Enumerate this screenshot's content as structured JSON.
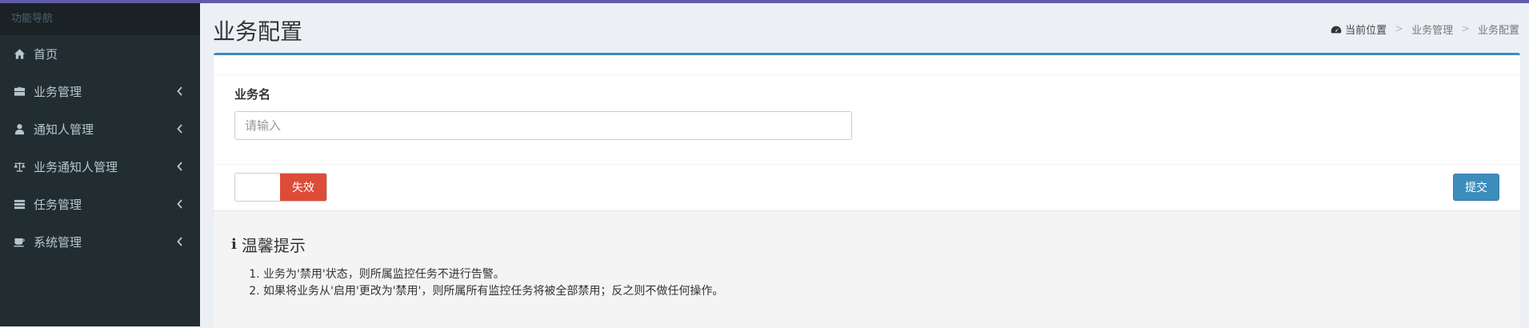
{
  "sidebar": {
    "header": "功能导航",
    "items": [
      {
        "label": "首页",
        "icon": "home-icon",
        "has_children": false
      },
      {
        "label": "业务管理",
        "icon": "briefcase-icon",
        "has_children": true
      },
      {
        "label": "通知人管理",
        "icon": "user-icon",
        "has_children": true
      },
      {
        "label": "业务通知人管理",
        "icon": "balance-scale-icon",
        "has_children": true
      },
      {
        "label": "任务管理",
        "icon": "tasks-icon",
        "has_children": true
      },
      {
        "label": "系统管理",
        "icon": "coffee-icon",
        "has_children": true
      }
    ]
  },
  "page": {
    "title": "业务配置"
  },
  "breadcrumb": {
    "icon": "dashboard-icon",
    "current_label": "当前位置",
    "items": [
      "业务管理",
      "业务配置"
    ]
  },
  "form": {
    "business_name_label": "业务名",
    "business_name_placeholder": "请输入",
    "business_name_value": "",
    "status_toggle_label": "失效",
    "submit_label": "提交"
  },
  "tips": {
    "title": "温馨提示",
    "items": [
      "业务为'禁用'状态，则所属监控任务不进行告警。",
      "如果将业务从'启用'更改为'禁用'，则所属所有监控任务将被全部禁用；反之则不做任何操作。"
    ]
  },
  "colors": {
    "sidebar_bg": "#222d32",
    "accent": "#3c8dbc",
    "danger": "#dd4b39",
    "top_bar": "#605ca8"
  }
}
